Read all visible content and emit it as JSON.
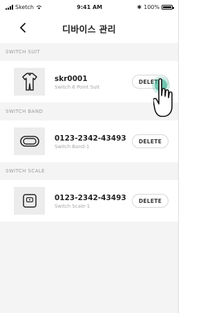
{
  "status_bar": {
    "carrier": "Sketch",
    "time": "9:41 AM",
    "battery": "100%"
  },
  "header": {
    "title": "디바이스 관리",
    "back_icon": "chevron-left-icon"
  },
  "sections": [
    {
      "label": "SWITCH SUIT",
      "device": {
        "icon": "suit-icon",
        "name": "skr0001",
        "subtitle": "Switch 6 Point Suit",
        "delete_label": "DELETE"
      }
    },
    {
      "label": "SWITCH BAND",
      "device": {
        "icon": "band-icon",
        "name": "0123-2342-43493",
        "subtitle": "Switch Band-1",
        "delete_label": "DELETE"
      }
    },
    {
      "label": "SWITCH SCALE",
      "device": {
        "icon": "scale-icon",
        "name": "0123-2342-43493",
        "subtitle": "Switch Scale-1",
        "delete_label": "DELETE"
      }
    }
  ],
  "colors": {
    "background": "#f4f4f4",
    "card": "#ffffff",
    "accent_tap": "#40b496"
  }
}
